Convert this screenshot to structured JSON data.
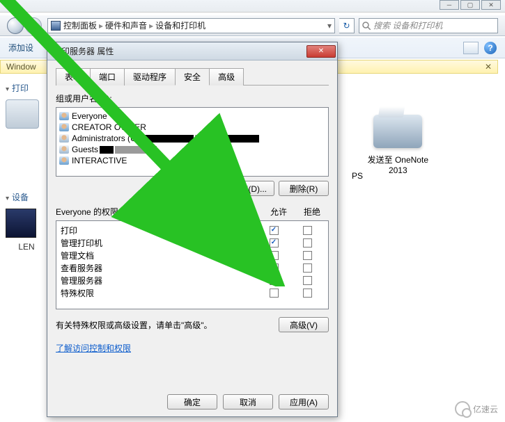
{
  "explorer": {
    "breadcrumb": [
      "控制面板",
      "硬件和声音",
      "设备和打印机"
    ],
    "search_placeholder": "搜索 设备和打印机",
    "yellow_bar_left": "Window",
    "cmdbar_item": "添加设",
    "help_glyph": "?"
  },
  "sidebar": {
    "section_print": "打印",
    "section_device": "设备",
    "dev_label": "LEN"
  },
  "right_pane": {
    "ps_suffix": "PS",
    "onenote_label_line1": "发送至 OneNote",
    "onenote_label_line2": "2013"
  },
  "dialog": {
    "title": "打印服务器 属性",
    "tabs": [
      "表单",
      "端口",
      "驱动程序",
      "安全",
      "高级"
    ],
    "active_tab": 3,
    "group_label": "组或用户名(G):",
    "users": [
      {
        "icon": "people",
        "label": "Everyone"
      },
      {
        "icon": "people",
        "label": "CREATOR OWNER",
        "redacted": false
      },
      {
        "icon": "single",
        "label": "Administrators (U",
        "redact_widths": [
          80,
          30,
          60
        ]
      },
      {
        "icon": "single",
        "label": "Guests",
        "redact_widths": [
          20,
          60
        ]
      },
      {
        "icon": "people",
        "label": "INTERACTIVE"
      }
    ],
    "add_button": "添加(D)...",
    "remove_button": "删除(R)",
    "perm_header_for": "Everyone 的权限(P)",
    "col_allow": "允许",
    "col_deny": "拒绝",
    "permissions": [
      {
        "name": "打印",
        "allow": true,
        "deny": false
      },
      {
        "name": "管理打印机",
        "allow": true,
        "deny": false
      },
      {
        "name": "管理文档",
        "allow": false,
        "deny": false
      },
      {
        "name": "查看服务器",
        "allow": true,
        "deny": false
      },
      {
        "name": "管理服务器",
        "allow": false,
        "deny": false
      },
      {
        "name": "特殊权限",
        "allow": false,
        "deny": false
      }
    ],
    "special_note": "有关特殊权限或高级设置，请单击\"高级\"。",
    "advanced_button": "高级(V)",
    "learn_link": "了解访问控制和权限",
    "ok": "确定",
    "cancel": "取消",
    "apply": "应用(A)"
  },
  "watermark": "亿速云"
}
